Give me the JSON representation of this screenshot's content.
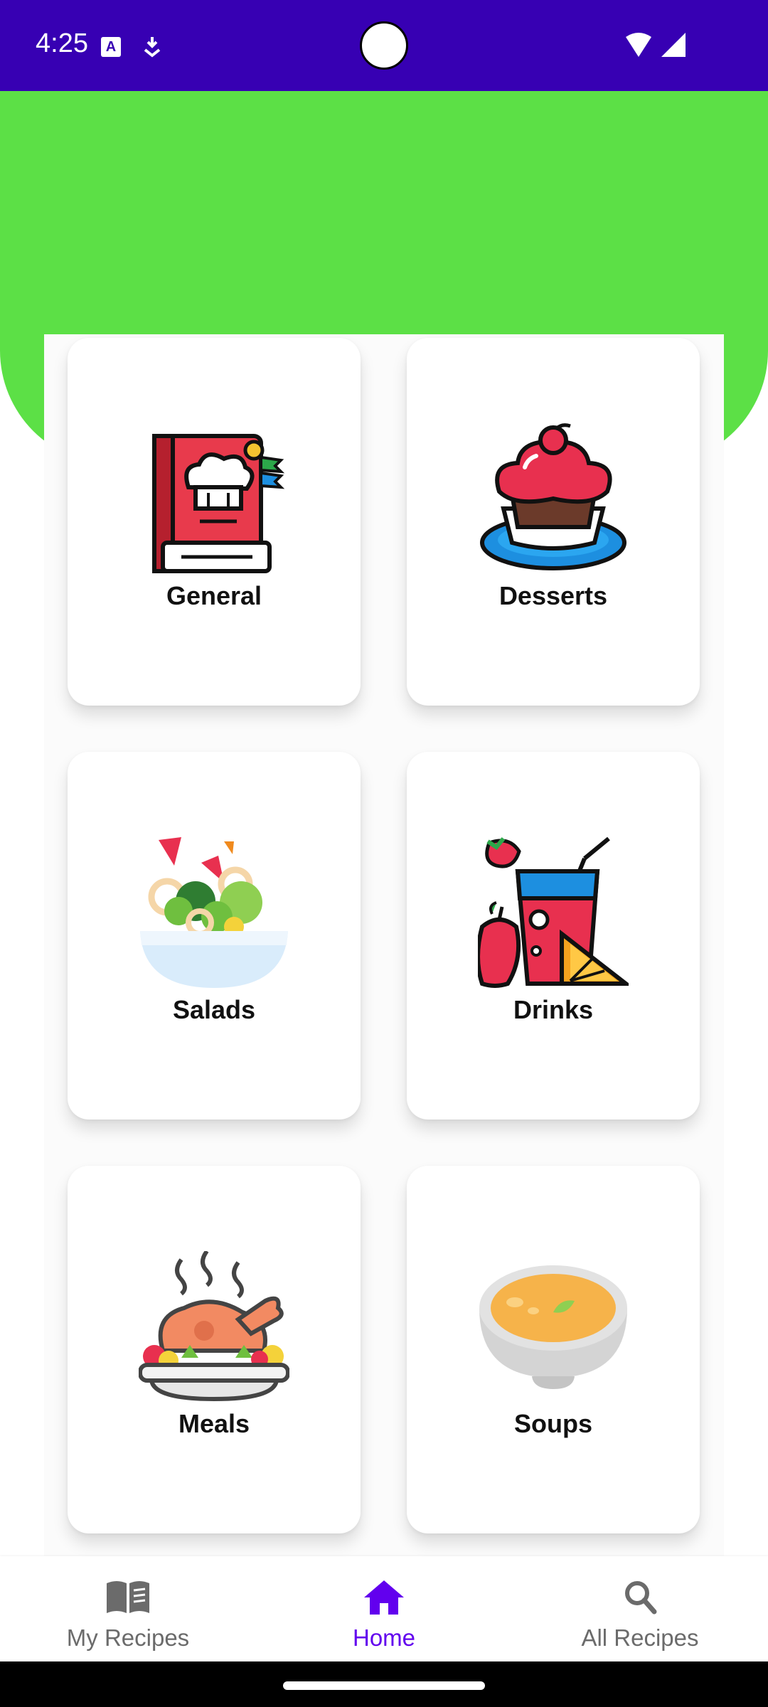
{
  "status_bar": {
    "time": "4:25",
    "icons": [
      "notification-a-icon",
      "download-icon",
      "wifi-icon",
      "cell-signal-icon"
    ],
    "color": "#3700b3"
  },
  "header": {
    "color": "#5ce046"
  },
  "categories": [
    {
      "label": "General",
      "icon": "cookbook-icon"
    },
    {
      "label": "Desserts",
      "icon": "cupcake-icon"
    },
    {
      "label": "Salads",
      "icon": "salad-bowl-icon"
    },
    {
      "label": "Drinks",
      "icon": "drink-glass-icon"
    },
    {
      "label": "Meals",
      "icon": "roast-chicken-icon"
    },
    {
      "label": "Soups",
      "icon": "soup-bowl-icon"
    }
  ],
  "bottom_nav": {
    "items": [
      {
        "label": "My Recipes",
        "icon": "book-icon",
        "active": false
      },
      {
        "label": "Home",
        "icon": "home-icon",
        "active": true
      },
      {
        "label": "All Recipes",
        "icon": "search-icon",
        "active": false
      }
    ],
    "active_color": "#6200ee",
    "inactive_color": "#6b6b6b"
  }
}
